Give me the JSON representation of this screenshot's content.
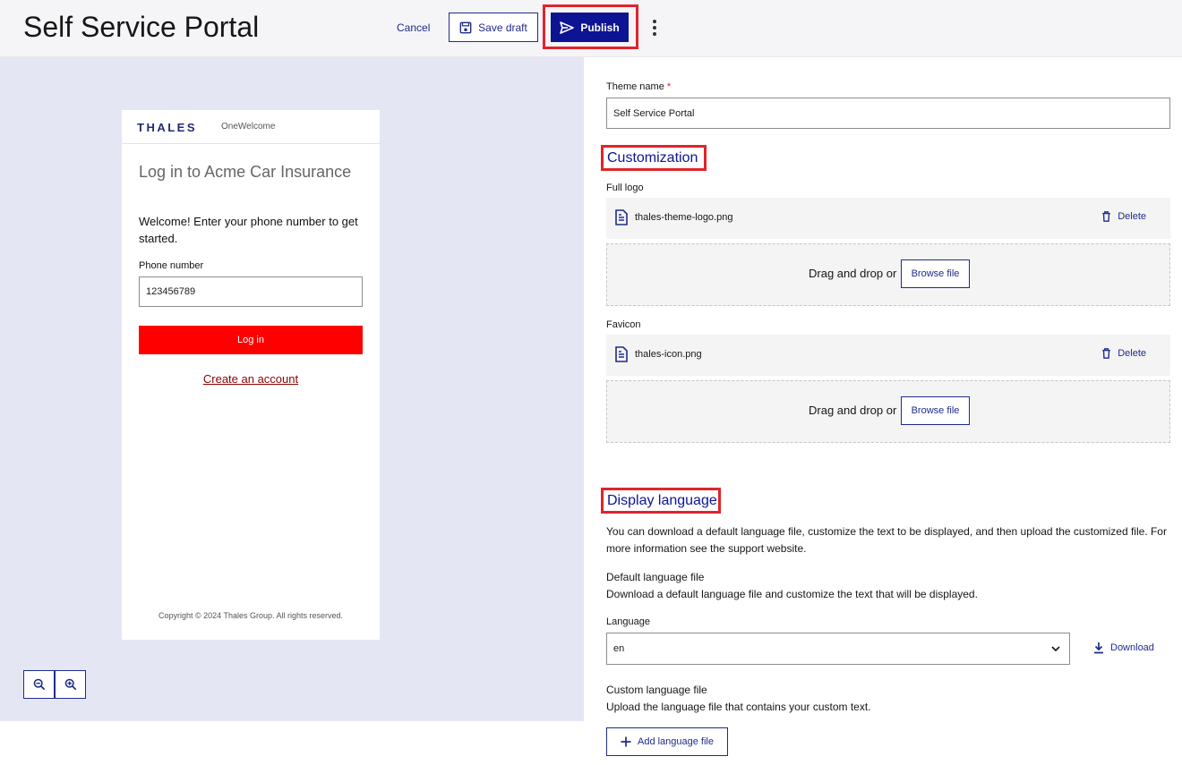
{
  "header": {
    "title": "Self Service Portal",
    "cancel_label": "Cancel",
    "save_draft_label": "Save draft",
    "publish_label": "Publish"
  },
  "preview": {
    "brand_logo": "THALES",
    "brand_subtitle": "OneWelcome",
    "heading": "Log in to Acme Car Insurance",
    "welcome": "Welcome! Enter your phone number to get started.",
    "phone_label": "Phone number",
    "phone_value": "123456789",
    "login_label": "Log in",
    "create_account_label": "Create an account",
    "copyright": "Copyright © 2024 Thales Group. All rights reserved."
  },
  "form": {
    "theme_name_label": "Theme name",
    "theme_name_required": "*",
    "theme_name_value": "Self Service Portal",
    "customization_title": "Customization",
    "full_logo_label": "Full logo",
    "full_logo_file": "thales-theme-logo.png",
    "favicon_label": "Favicon",
    "favicon_file": "thales-icon.png",
    "delete_label": "Delete",
    "drag_drop_text": "Drag and drop or",
    "browse_label": "Browse file",
    "display_language_title": "Display language",
    "display_language_desc": "You can download a default language file, customize the text to be displayed, and then upload the customized file. For more information see the support website.",
    "default_file_title": "Default language file",
    "default_file_desc": "Download a default language file and customize the text that will be displayed.",
    "language_label": "Language",
    "language_value": "en",
    "download_label": "Download",
    "custom_file_title": "Custom language file",
    "custom_file_desc": "Upload the language file that contains your custom text.",
    "add_language_label": "Add language file"
  },
  "colors": {
    "primary": "#0c1493",
    "highlight": "#e0242b",
    "login_button": "#ff0000",
    "preview_bg": "#e4e6f4"
  },
  "icons": [
    "save-icon",
    "send-icon",
    "kebab-menu-icon",
    "file-icon",
    "trash-icon",
    "chevron-down-icon",
    "download-icon",
    "plus-icon",
    "zoom-out-icon",
    "zoom-in-icon"
  ]
}
